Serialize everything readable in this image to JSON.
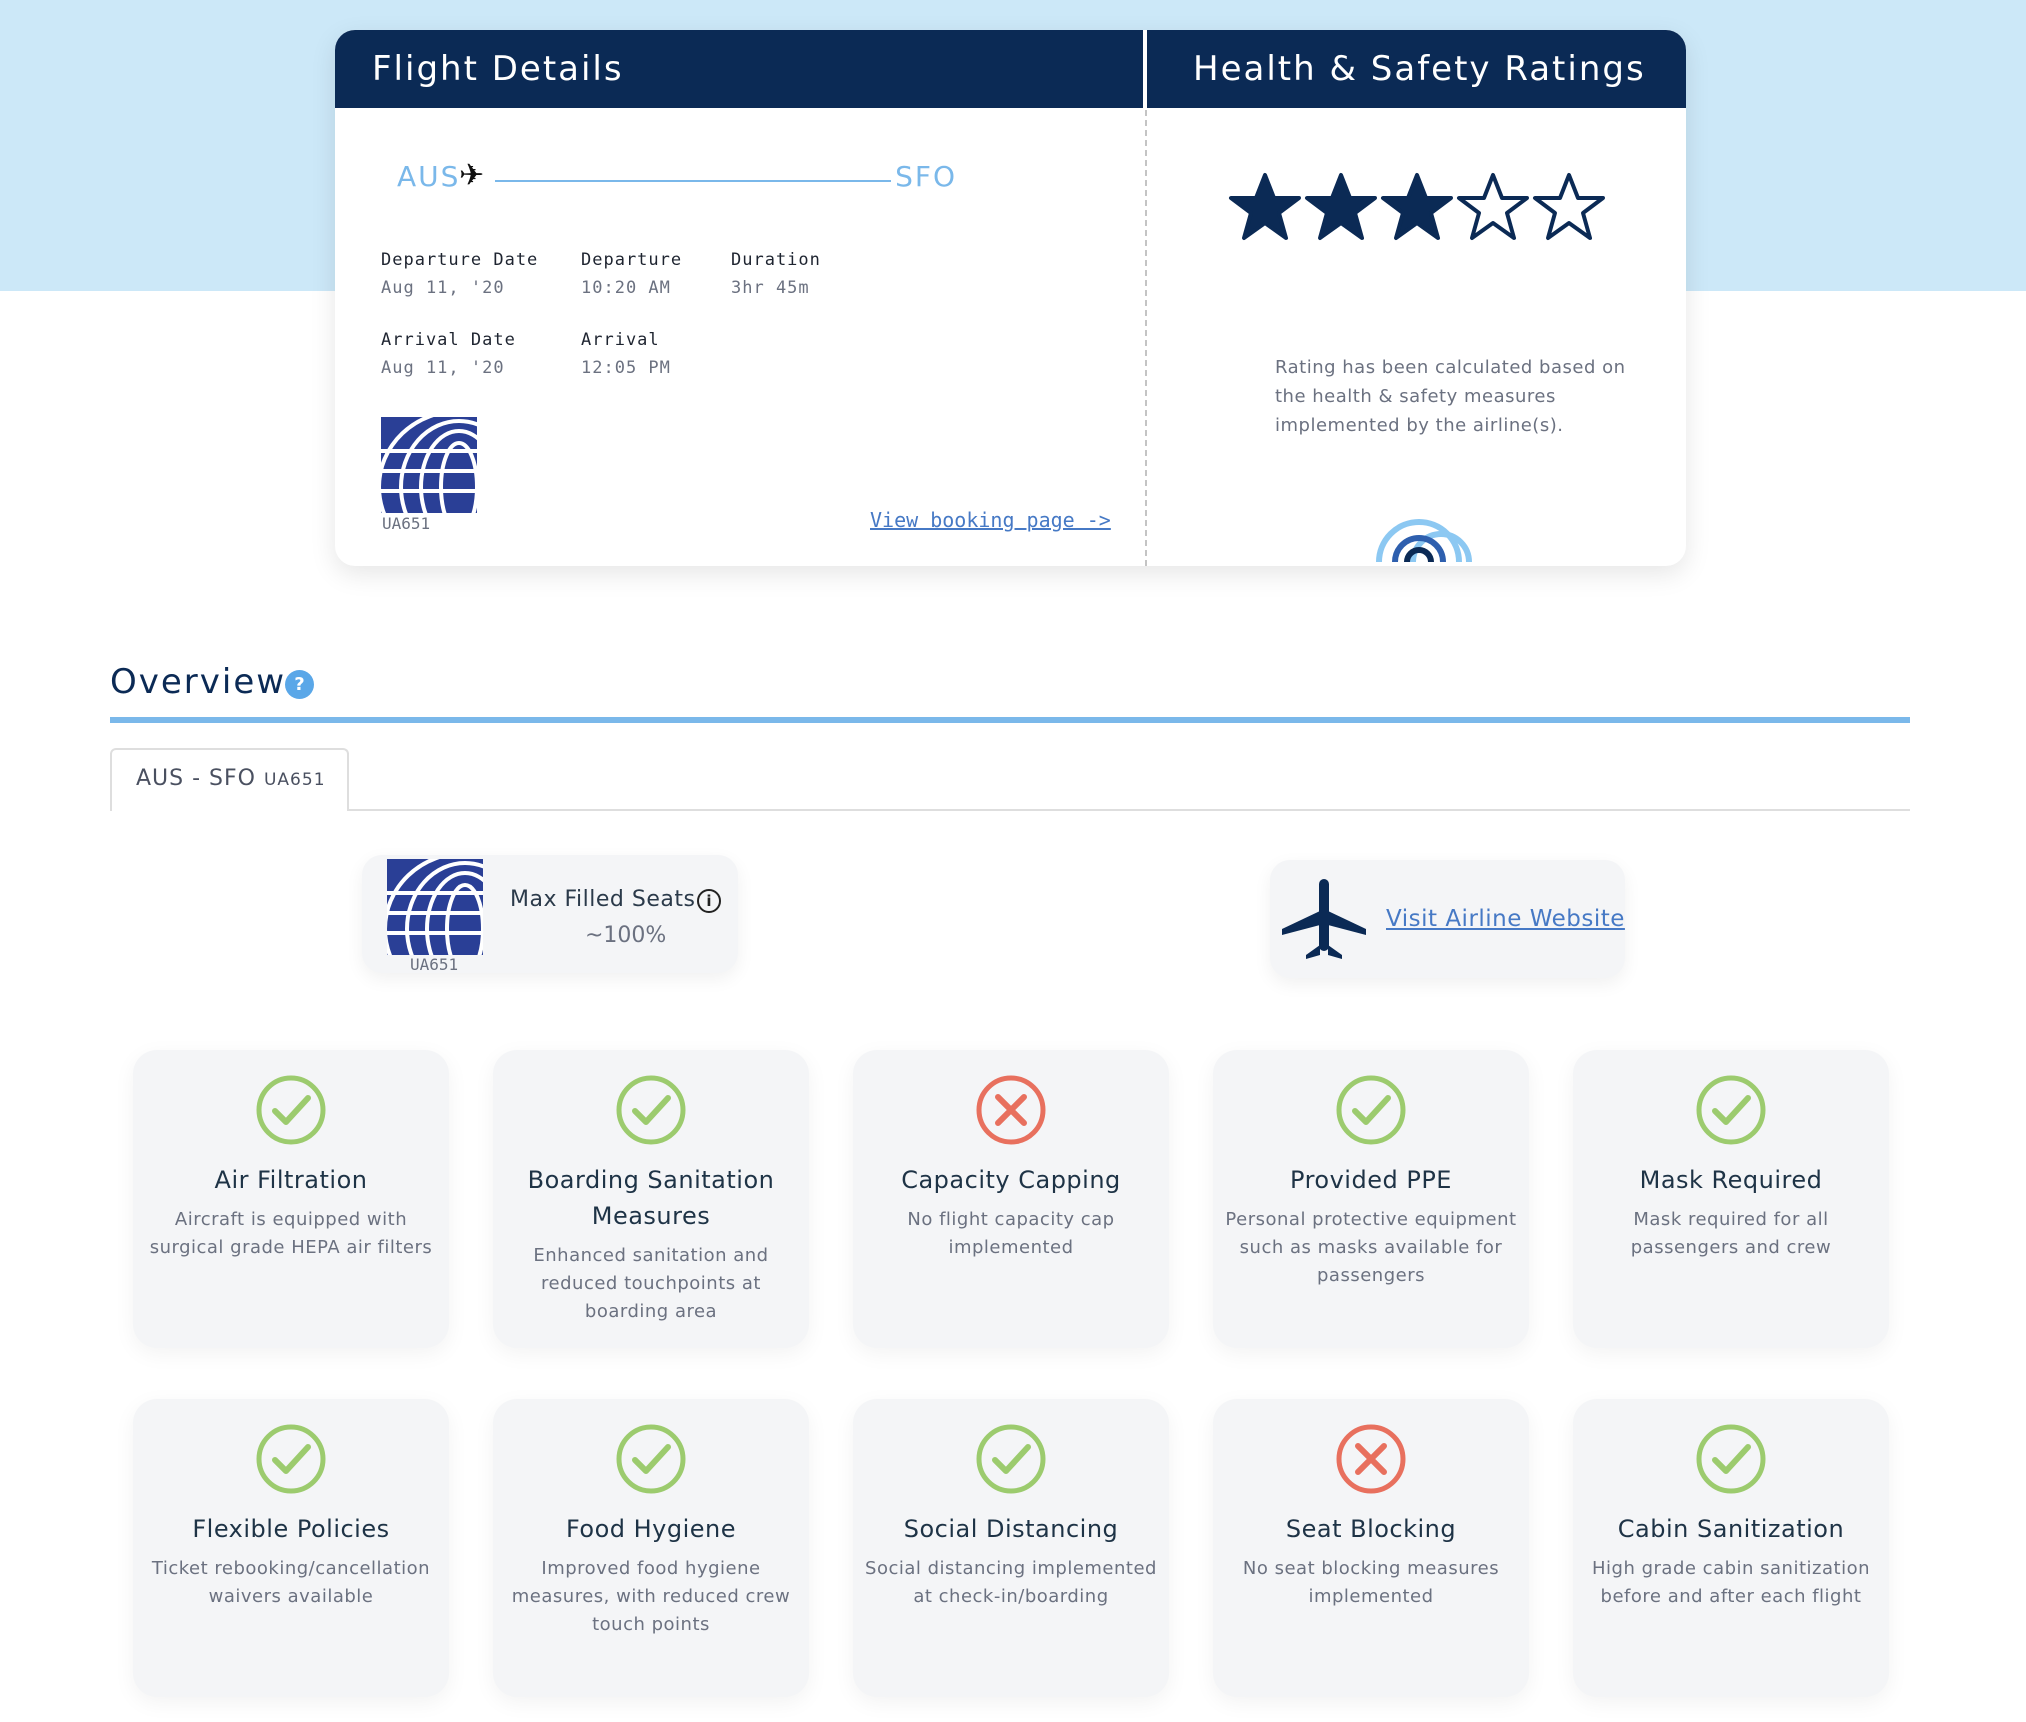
{
  "flight_card": {
    "title": "Flight Details",
    "from": "AUS",
    "to": "SFO",
    "departure_date_label": "Departure Date",
    "departure_date": "Aug 11, '20",
    "departure_label": "Departure",
    "departure_time": "10:20 AM",
    "duration_label": "Duration",
    "duration": "3hr 45m",
    "arrival_date_label": "Arrival Date",
    "arrival_date": "Aug 11, '20",
    "arrival_label": "Arrival",
    "arrival_time": "12:05 PM",
    "flight_code": "UA651",
    "booking_link": "View booking page ->"
  },
  "ratings": {
    "title": "Health & Safety Ratings",
    "stars_filled": 3,
    "stars_total": 5,
    "note": "Rating has been calculated based on the health & safety measures implemented by the airline(s)."
  },
  "overview": {
    "title": "Overview",
    "help_icon": "?",
    "tab_route": "AUS - SFO",
    "tab_code": "UA651"
  },
  "seats_card": {
    "flight_code": "UA651",
    "title": "Max Filled Seats",
    "value": "~100%",
    "info_icon": "i"
  },
  "airline_card": {
    "link": "Visit Airline Website"
  },
  "colors": {
    "navy": "#0b2a55",
    "light_blue": "#cce8f8",
    "accent_blue": "#7ab8ea",
    "check_green": "#9ccb6e",
    "cross_red": "#e8705e",
    "link_blue": "#4679c5"
  },
  "measures": [
    {
      "status": "yes",
      "title": "Air Filtration",
      "desc": "Aircraft is equipped with surgical grade HEPA air filters"
    },
    {
      "status": "yes",
      "title": "Boarding Sanitation Measures",
      "desc": "Enhanced sanitation and reduced touchpoints at boarding area"
    },
    {
      "status": "no",
      "title": "Capacity Capping",
      "desc": "No flight capacity cap implemented"
    },
    {
      "status": "yes",
      "title": "Provided PPE",
      "desc": "Personal protective equipment such as masks available for passengers"
    },
    {
      "status": "yes",
      "title": "Mask Required",
      "desc": "Mask required for all passengers and crew"
    },
    {
      "status": "yes",
      "title": "Flexible Policies",
      "desc": "Ticket rebooking/cancellation waivers available"
    },
    {
      "status": "yes",
      "title": "Food Hygiene",
      "desc": "Improved food hygiene measures, with reduced crew touch points"
    },
    {
      "status": "yes",
      "title": "Social Distancing",
      "desc": "Social distancing implemented at check-in/boarding"
    },
    {
      "status": "no",
      "title": "Seat Blocking",
      "desc": "No seat blocking measures implemented"
    },
    {
      "status": "yes",
      "title": "Cabin Sanitization",
      "desc": "High grade cabin sanitization before and after each flight"
    }
  ]
}
